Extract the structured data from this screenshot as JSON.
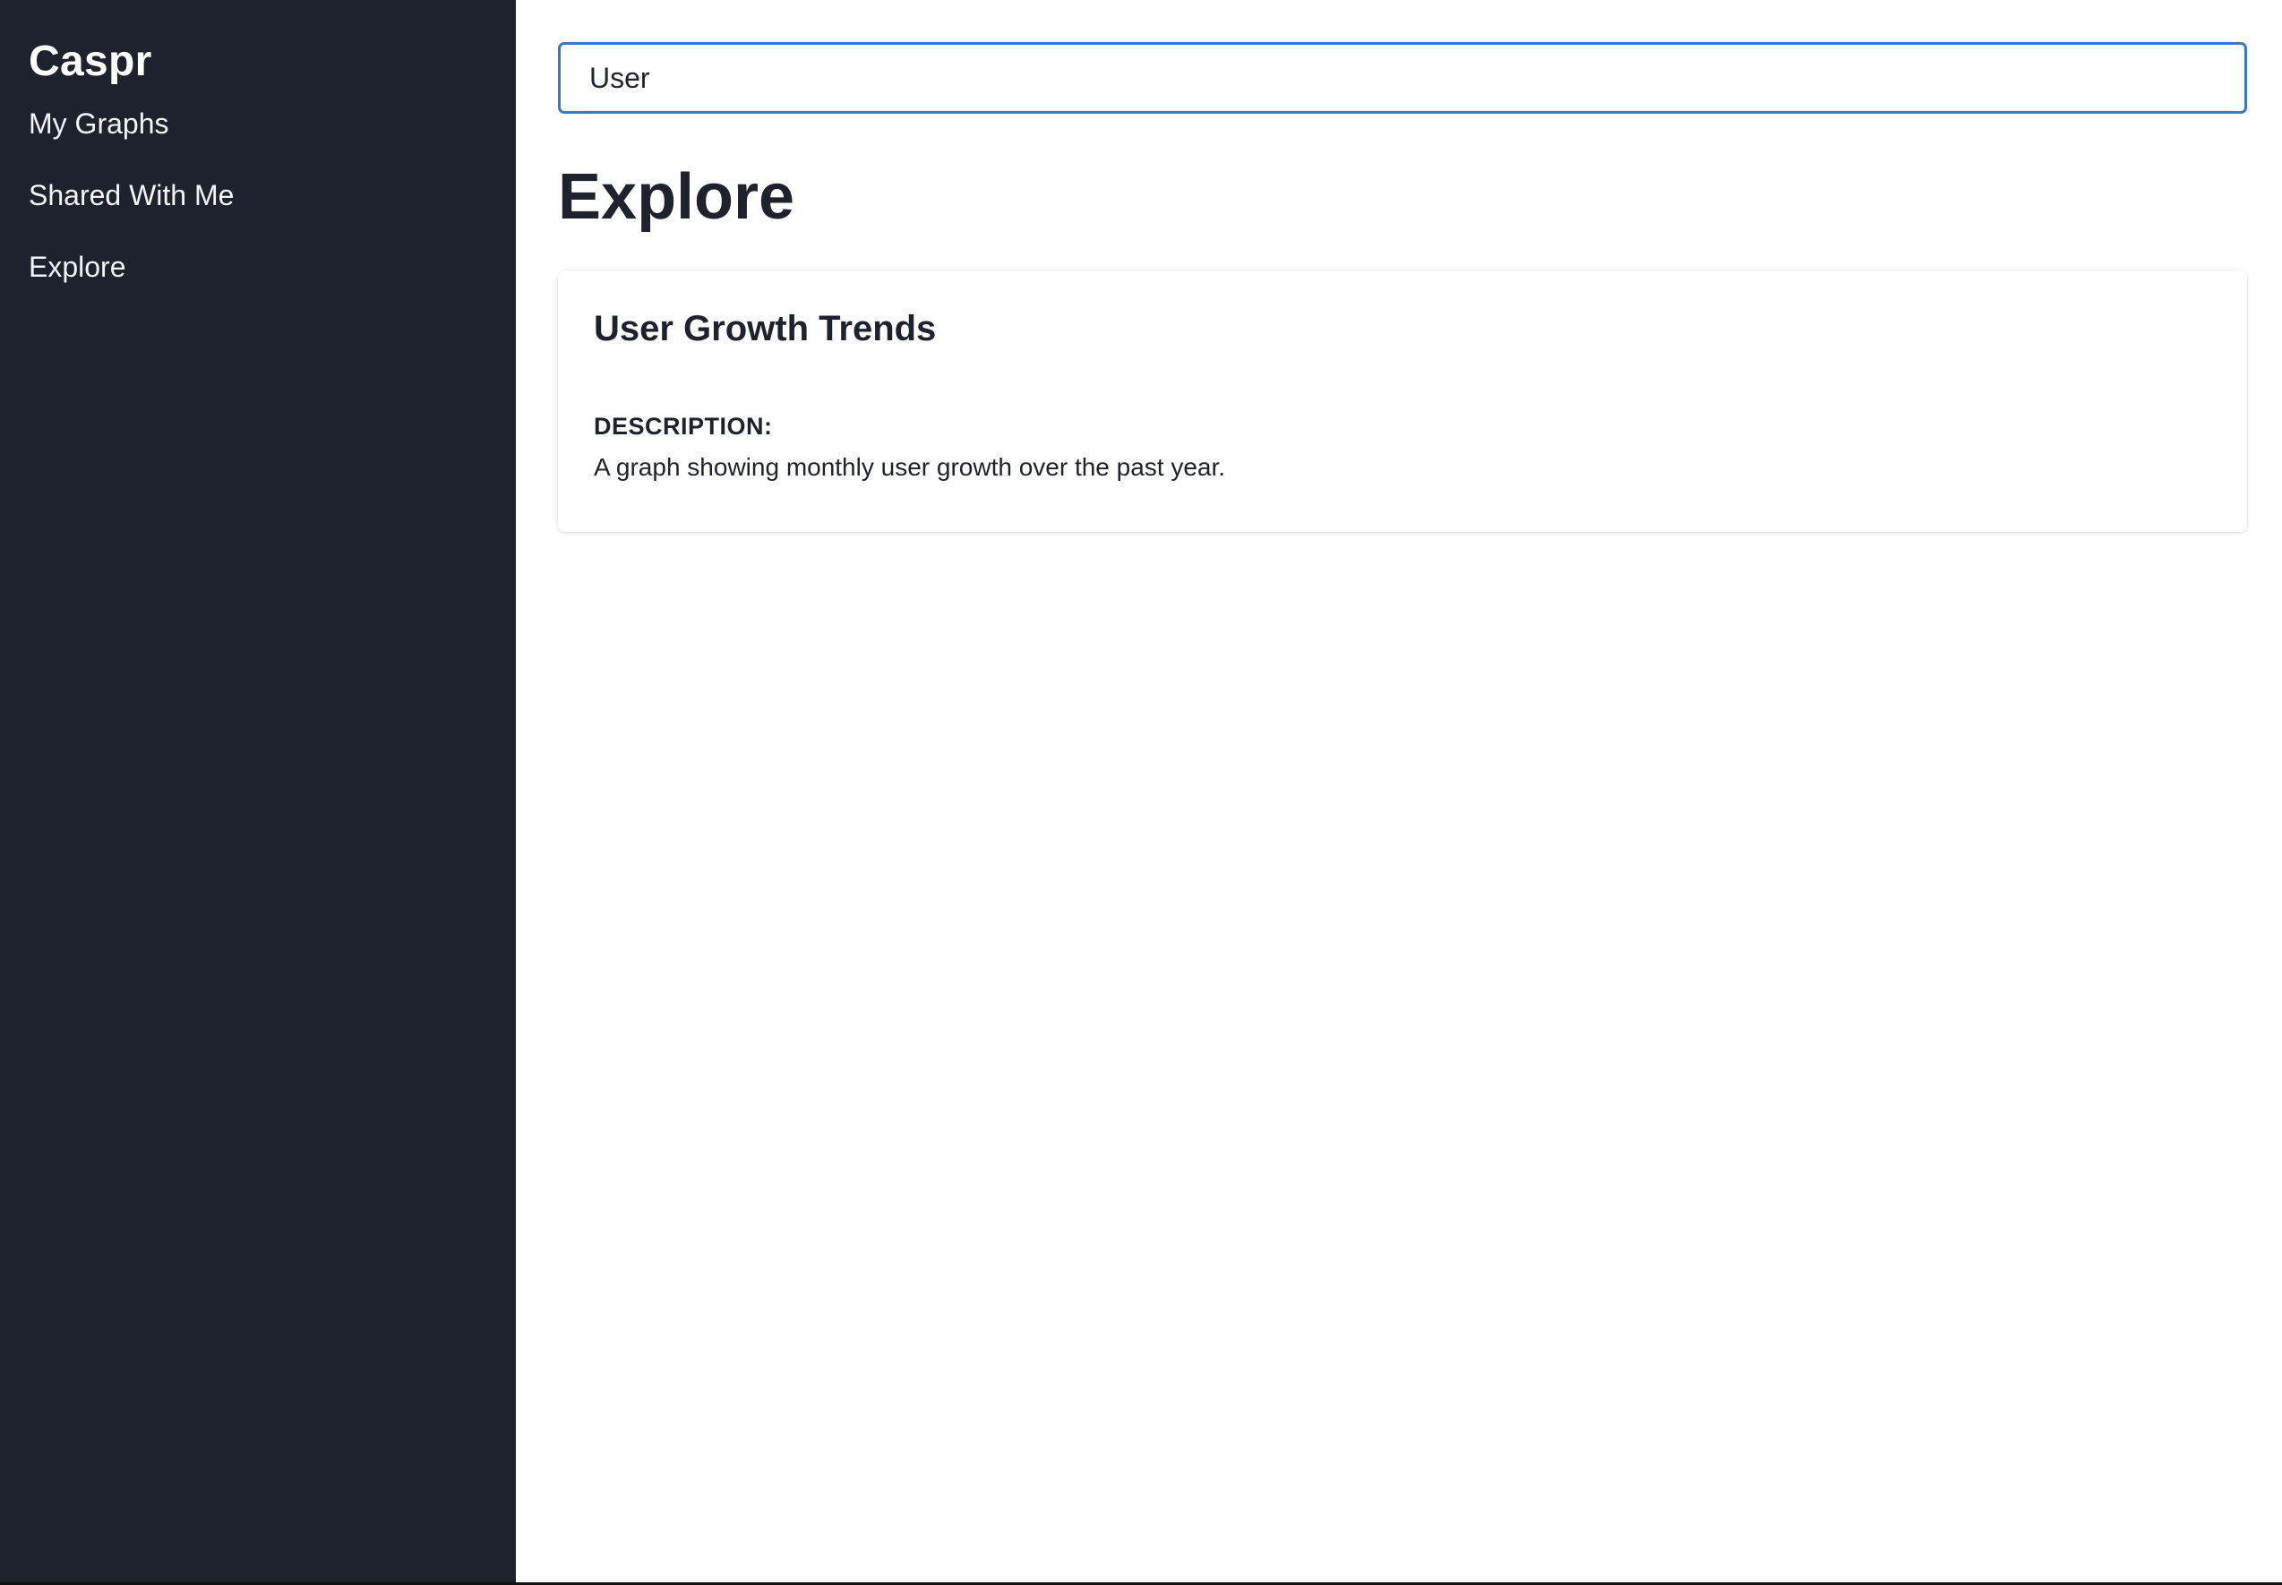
{
  "sidebar": {
    "brand": "Caspr",
    "items": [
      {
        "label": "My Graphs"
      },
      {
        "label": "Shared With Me"
      },
      {
        "label": "Explore"
      }
    ]
  },
  "search": {
    "value": "User",
    "placeholder": ""
  },
  "main": {
    "title": "Explore",
    "cards": [
      {
        "title": "User Growth Trends",
        "description_label": "DESCRIPTION:",
        "description": "A graph showing monthly user growth over the past year."
      }
    ]
  },
  "colors": {
    "sidebar_bg": "#1e222d",
    "accent": "#3b78c4",
    "text_dark": "#1e222d"
  }
}
